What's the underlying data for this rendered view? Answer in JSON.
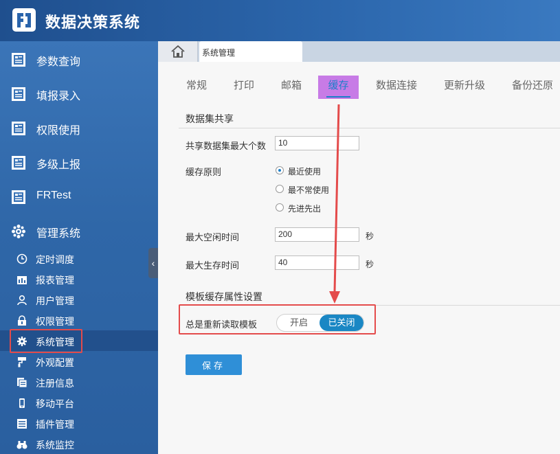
{
  "app": {
    "title": "数据决策系统"
  },
  "sidebar": {
    "items": [
      {
        "label": "参数查询",
        "icon": "report-icon"
      },
      {
        "label": "填报录入",
        "icon": "report-icon"
      },
      {
        "label": "权限使用",
        "icon": "report-icon"
      },
      {
        "label": "多级上报",
        "icon": "report-icon"
      },
      {
        "label": "FRTest",
        "icon": "report-icon"
      },
      {
        "label": "管理系统",
        "icon": "gear-cluster-icon"
      }
    ],
    "sub_items": [
      {
        "label": "定时调度",
        "icon": "clock-icon"
      },
      {
        "label": "报表管理",
        "icon": "report-manage-icon"
      },
      {
        "label": "用户管理",
        "icon": "user-icon"
      },
      {
        "label": "权限管理",
        "icon": "lock-icon"
      },
      {
        "label": "系统管理",
        "icon": "gear-icon",
        "active": true
      },
      {
        "label": "外观配置",
        "icon": "paint-roller-icon"
      },
      {
        "label": "注册信息",
        "icon": "register-icon"
      },
      {
        "label": "移动平台",
        "icon": "mobile-icon"
      },
      {
        "label": "插件管理",
        "icon": "plugin-icon"
      },
      {
        "label": "系统监控",
        "icon": "binoculars-icon"
      }
    ]
  },
  "tabs": {
    "home_icon": "home-icon",
    "current": "系统管理"
  },
  "settings_tabs": [
    "常规",
    "打印",
    "邮箱",
    "缓存",
    "数据连接",
    "更新升级",
    "备份还原"
  ],
  "active_settings_tab": "缓存",
  "dataset_share": {
    "title": "数据集共享",
    "max_count_label": "共享数据集最大个数",
    "max_count_value": "10",
    "cache_rule_label": "缓存原则",
    "cache_rule_options": [
      "最近使用",
      "最不常使用",
      "先进先出"
    ],
    "cache_rule_selected": "最近使用",
    "max_idle_label": "最大空闲时间",
    "max_idle_value": "200",
    "max_idle_unit": "秒",
    "max_live_label": "最大生存时间",
    "max_live_value": "40",
    "max_live_unit": "秒"
  },
  "template_cache": {
    "title": "模板缓存属性设置",
    "reload_label": "总是重新读取模板",
    "toggle_on_label": "开启",
    "toggle_off_label": "已关闭",
    "toggle_state": "off"
  },
  "save_label": "保存",
  "colors": {
    "accent": "#1a7fc9",
    "highlight_tab": "#c77be6",
    "annotation_red": "#e44b4b",
    "sidebar_bg": "#2f67a8"
  }
}
